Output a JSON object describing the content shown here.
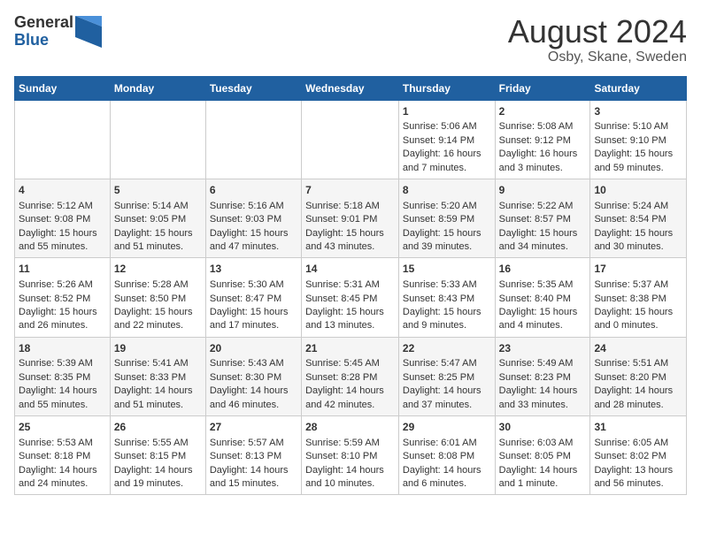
{
  "header": {
    "logo_general": "General",
    "logo_blue": "Blue",
    "title": "August 2024",
    "subtitle": "Osby, Skane, Sweden"
  },
  "days_of_week": [
    "Sunday",
    "Monday",
    "Tuesday",
    "Wednesday",
    "Thursday",
    "Friday",
    "Saturday"
  ],
  "weeks": [
    [
      {
        "day": "",
        "content": ""
      },
      {
        "day": "",
        "content": ""
      },
      {
        "day": "",
        "content": ""
      },
      {
        "day": "",
        "content": ""
      },
      {
        "day": "1",
        "content": "Sunrise: 5:06 AM\nSunset: 9:14 PM\nDaylight: 16 hours\nand 7 minutes."
      },
      {
        "day": "2",
        "content": "Sunrise: 5:08 AM\nSunset: 9:12 PM\nDaylight: 16 hours\nand 3 minutes."
      },
      {
        "day": "3",
        "content": "Sunrise: 5:10 AM\nSunset: 9:10 PM\nDaylight: 15 hours\nand 59 minutes."
      }
    ],
    [
      {
        "day": "4",
        "content": "Sunrise: 5:12 AM\nSunset: 9:08 PM\nDaylight: 15 hours\nand 55 minutes."
      },
      {
        "day": "5",
        "content": "Sunrise: 5:14 AM\nSunset: 9:05 PM\nDaylight: 15 hours\nand 51 minutes."
      },
      {
        "day": "6",
        "content": "Sunrise: 5:16 AM\nSunset: 9:03 PM\nDaylight: 15 hours\nand 47 minutes."
      },
      {
        "day": "7",
        "content": "Sunrise: 5:18 AM\nSunset: 9:01 PM\nDaylight: 15 hours\nand 43 minutes."
      },
      {
        "day": "8",
        "content": "Sunrise: 5:20 AM\nSunset: 8:59 PM\nDaylight: 15 hours\nand 39 minutes."
      },
      {
        "day": "9",
        "content": "Sunrise: 5:22 AM\nSunset: 8:57 PM\nDaylight: 15 hours\nand 34 minutes."
      },
      {
        "day": "10",
        "content": "Sunrise: 5:24 AM\nSunset: 8:54 PM\nDaylight: 15 hours\nand 30 minutes."
      }
    ],
    [
      {
        "day": "11",
        "content": "Sunrise: 5:26 AM\nSunset: 8:52 PM\nDaylight: 15 hours\nand 26 minutes."
      },
      {
        "day": "12",
        "content": "Sunrise: 5:28 AM\nSunset: 8:50 PM\nDaylight: 15 hours\nand 22 minutes."
      },
      {
        "day": "13",
        "content": "Sunrise: 5:30 AM\nSunset: 8:47 PM\nDaylight: 15 hours\nand 17 minutes."
      },
      {
        "day": "14",
        "content": "Sunrise: 5:31 AM\nSunset: 8:45 PM\nDaylight: 15 hours\nand 13 minutes."
      },
      {
        "day": "15",
        "content": "Sunrise: 5:33 AM\nSunset: 8:43 PM\nDaylight: 15 hours\nand 9 minutes."
      },
      {
        "day": "16",
        "content": "Sunrise: 5:35 AM\nSunset: 8:40 PM\nDaylight: 15 hours\nand 4 minutes."
      },
      {
        "day": "17",
        "content": "Sunrise: 5:37 AM\nSunset: 8:38 PM\nDaylight: 15 hours\nand 0 minutes."
      }
    ],
    [
      {
        "day": "18",
        "content": "Sunrise: 5:39 AM\nSunset: 8:35 PM\nDaylight: 14 hours\nand 55 minutes."
      },
      {
        "day": "19",
        "content": "Sunrise: 5:41 AM\nSunset: 8:33 PM\nDaylight: 14 hours\nand 51 minutes."
      },
      {
        "day": "20",
        "content": "Sunrise: 5:43 AM\nSunset: 8:30 PM\nDaylight: 14 hours\nand 46 minutes."
      },
      {
        "day": "21",
        "content": "Sunrise: 5:45 AM\nSunset: 8:28 PM\nDaylight: 14 hours\nand 42 minutes."
      },
      {
        "day": "22",
        "content": "Sunrise: 5:47 AM\nSunset: 8:25 PM\nDaylight: 14 hours\nand 37 minutes."
      },
      {
        "day": "23",
        "content": "Sunrise: 5:49 AM\nSunset: 8:23 PM\nDaylight: 14 hours\nand 33 minutes."
      },
      {
        "day": "24",
        "content": "Sunrise: 5:51 AM\nSunset: 8:20 PM\nDaylight: 14 hours\nand 28 minutes."
      }
    ],
    [
      {
        "day": "25",
        "content": "Sunrise: 5:53 AM\nSunset: 8:18 PM\nDaylight: 14 hours\nand 24 minutes."
      },
      {
        "day": "26",
        "content": "Sunrise: 5:55 AM\nSunset: 8:15 PM\nDaylight: 14 hours\nand 19 minutes."
      },
      {
        "day": "27",
        "content": "Sunrise: 5:57 AM\nSunset: 8:13 PM\nDaylight: 14 hours\nand 15 minutes."
      },
      {
        "day": "28",
        "content": "Sunrise: 5:59 AM\nSunset: 8:10 PM\nDaylight: 14 hours\nand 10 minutes."
      },
      {
        "day": "29",
        "content": "Sunrise: 6:01 AM\nSunset: 8:08 PM\nDaylight: 14 hours\nand 6 minutes."
      },
      {
        "day": "30",
        "content": "Sunrise: 6:03 AM\nSunset: 8:05 PM\nDaylight: 14 hours\nand 1 minute."
      },
      {
        "day": "31",
        "content": "Sunrise: 6:05 AM\nSunset: 8:02 PM\nDaylight: 13 hours\nand 56 minutes."
      }
    ]
  ]
}
